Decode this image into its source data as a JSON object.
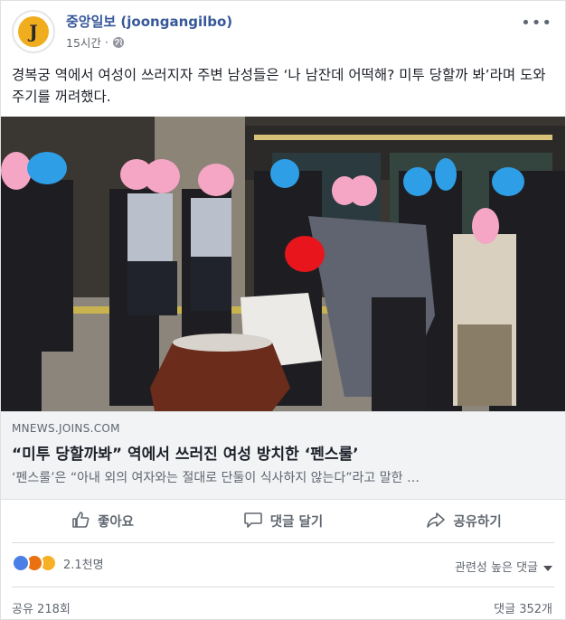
{
  "post": {
    "page_name": "중앙일보 (joongangilbo)",
    "avatar_letter": "J",
    "time": "15시간",
    "separator": "·",
    "more_label": "•••",
    "text": "경복궁 역에서 여성이 쓰러지자 주변 남성들은 ‘나 남잔데 어떡해? 미투 당할까 봐’라며 도와주기를 꺼려했다."
  },
  "link": {
    "domain": "MNEWS.JOINS.COM",
    "title": "“미투 당할까봐” 역에서 쓰러진 여성 방치한 ‘펜스룰’",
    "description": "‘펜스룰’은 “아내 외의 여자와는 절대로 단둘이 식사하지 않는다”라고 말한 …"
  },
  "actions": {
    "like": "좋아요",
    "comment": "댓글 달기",
    "share": "공유하기"
  },
  "reactions": {
    "count": "2.1천명",
    "types": [
      "like-icon",
      "angry-icon",
      "sad-icon"
    ],
    "sort_label": "관련성 높은 댓글"
  },
  "footer": {
    "shares": "공유 218회",
    "comments": "댓글 352개"
  },
  "colors": {
    "link_blue": "#365899",
    "meta_gray": "#606770",
    "avatar_gold": "#f0ad1e",
    "like_blue": "#4a7fe8"
  }
}
